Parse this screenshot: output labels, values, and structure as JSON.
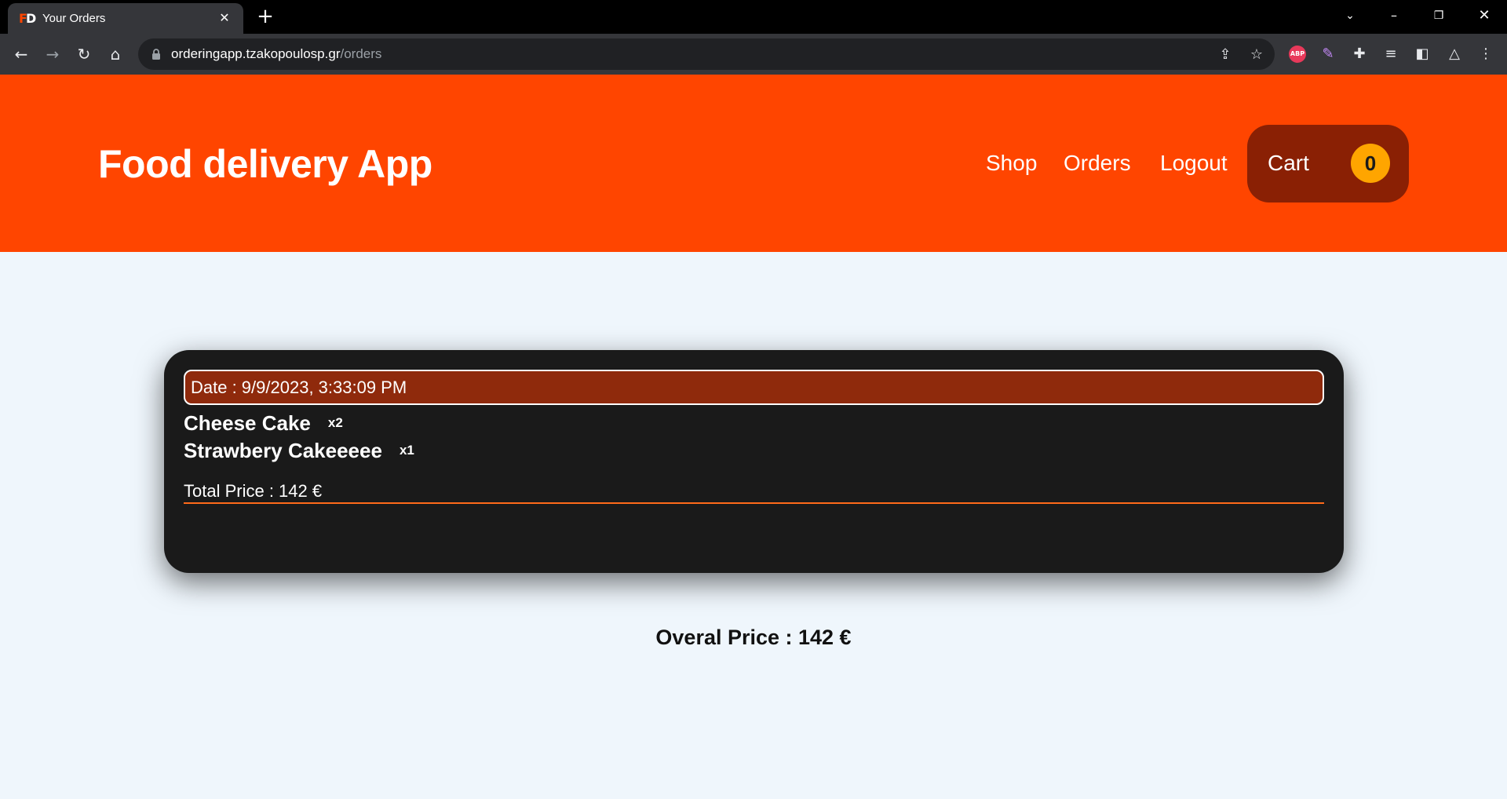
{
  "browser": {
    "tab_title": "Your Orders",
    "tab_favicon_letters": [
      "F",
      "D"
    ],
    "url_host": "orderingapp.tzakopoulosp.gr",
    "url_path": "/orders",
    "extensions": [
      {
        "name": "adblock-plus-icon",
        "label": "ABP"
      },
      {
        "name": "feather-extension-icon"
      },
      {
        "name": "puzzle-extensions-icon"
      },
      {
        "name": "media-playlist-icon"
      },
      {
        "name": "side-panel-icon"
      },
      {
        "name": "triangle-extension-icon"
      }
    ]
  },
  "header": {
    "logo": "Food delivery App",
    "nav": [
      {
        "label": "Shop"
      },
      {
        "label": "Orders"
      },
      {
        "label": "Logout"
      }
    ],
    "cart": {
      "label": "Cart",
      "count": "0"
    }
  },
  "orders": [
    {
      "date": "Date : 9/9/2023, 3:33:09 PM",
      "items": [
        {
          "name": "Cheese Cake",
          "qty": "x2"
        },
        {
          "name": "Strawbery Cakeeeee",
          "qty": "x1"
        }
      ],
      "total": "Total Price : 142 €"
    }
  ],
  "overall": "Overal Price : 142 €",
  "colors": {
    "brand": "#ff4500",
    "cart_bg": "#8a2004",
    "cart_badge": "#ffa500",
    "card_bg": "#1a1a1a",
    "date_bar": "#8f2a0c",
    "page_bg": "#eff6fc"
  }
}
